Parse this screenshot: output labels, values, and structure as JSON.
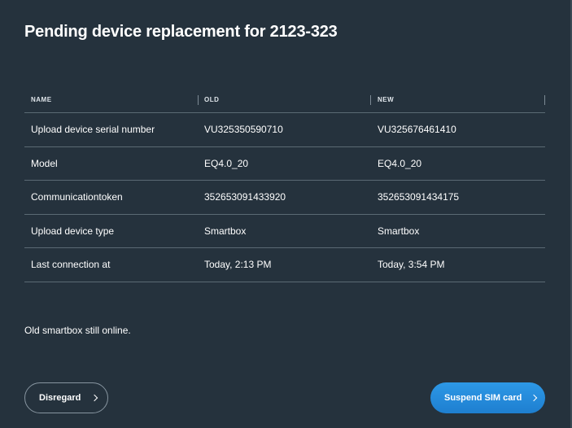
{
  "dialog": {
    "title": "Pending device replacement for 2123-323",
    "status": "Old smartbox still online."
  },
  "table": {
    "columns": [
      "NAME",
      "OLD",
      "NEW"
    ],
    "rows": [
      [
        "Upload device serial number",
        "VU325350590710",
        "VU325676461410"
      ],
      [
        "Model",
        "EQ4.0_20",
        "EQ4.0_20"
      ],
      [
        "Communicationtoken",
        "352653091433920",
        "352653091434175"
      ],
      [
        "Upload device type",
        "Smartbox",
        "Smartbox"
      ],
      [
        "Last connection at",
        "Today, 2:13 PM",
        "Today, 3:54 PM"
      ]
    ]
  },
  "buttons": {
    "disregard": "Disregard",
    "suspend": "Suspend SIM card"
  },
  "icons": {
    "disregard": "chevron-right-icon",
    "suspend": "chevron-right-icon"
  },
  "colors": {
    "background": "#25323d",
    "accent": "#2a8fe0",
    "divider": "#5b6a74"
  }
}
